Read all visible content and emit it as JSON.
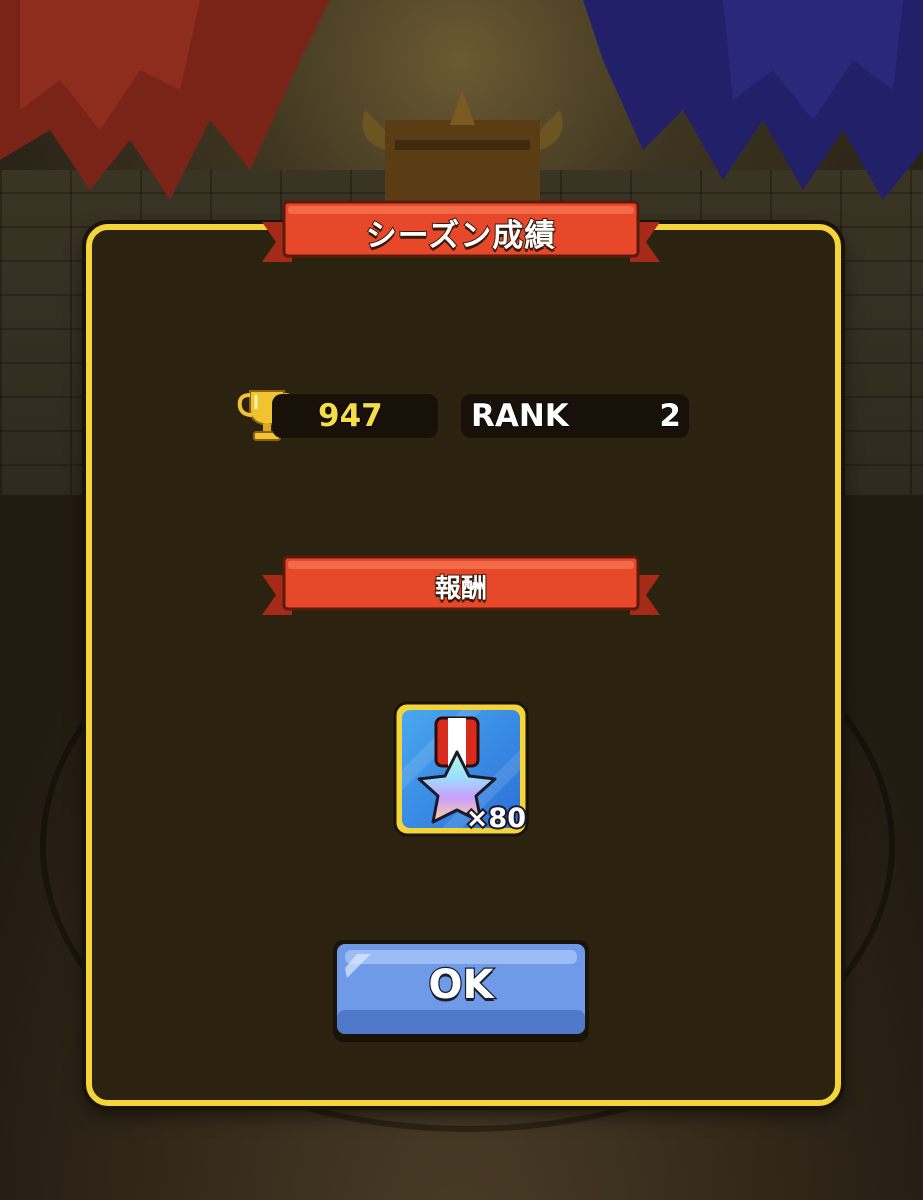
{
  "dialog": {
    "title": "シーズン成績",
    "trophy_count": "947",
    "rank_label": "RANK",
    "rank_value": "2",
    "reward_heading": "報酬",
    "reward": {
      "icon": "rainbow-star-medal-icon",
      "quantity": "×80"
    },
    "ok_label": "OK"
  },
  "colors": {
    "frame": "#f5d33a",
    "panel": "#2b2210",
    "ribbon": "#e8482a",
    "button": "#6f9ae8",
    "trophy_text": "#f7dc4a"
  }
}
